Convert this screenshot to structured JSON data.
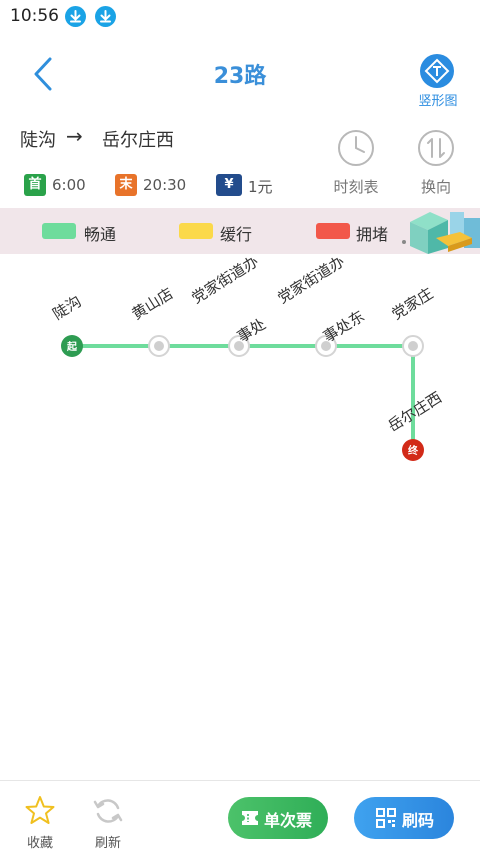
{
  "status_bar": {
    "time": "10:56",
    "icons": [
      "download-icon",
      "download-icon"
    ]
  },
  "header": {
    "title": "23路",
    "back_icon": "chevron-left-icon",
    "vertical_view_label": "竖形图",
    "accent_color": "#3a8fd9"
  },
  "route": {
    "from": "陡沟",
    "arrow": "→",
    "to": "岳尔庄西",
    "first_bus_badge": "首",
    "first_bus_time": "6:00",
    "last_bus_badge": "末",
    "last_bus_time": "20:30",
    "fare_badge": "¥",
    "fare": "1元",
    "first_badge_color": "#2aa24a",
    "last_badge_color": "#e8732a",
    "fare_badge_color": "#234c8c"
  },
  "actions": {
    "timetable_label": "时刻表",
    "reverse_label": "换向"
  },
  "legend": {
    "items": [
      {
        "label": "畅通",
        "color": "#6edc9c"
      },
      {
        "label": "缓行",
        "color": "#fbd94a"
      },
      {
        "label": "拥堵",
        "color": "#f2584a"
      }
    ]
  },
  "stops": [
    {
      "name": "陡沟",
      "tag": "起"
    },
    {
      "name": "黄山店"
    },
    {
      "name": "党家街道办事处"
    },
    {
      "name": "党家街道办事处东"
    },
    {
      "name": "党家庄"
    },
    {
      "name": "岳尔庄西",
      "tag": "终"
    }
  ],
  "stop_label_lines": [
    [
      "陡沟"
    ],
    [
      "黄山店"
    ],
    [
      "党家街道办",
      "事处"
    ],
    [
      "党家街道办",
      "事处东"
    ],
    [
      "党家庄"
    ],
    [
      "岳尔庄西"
    ]
  ],
  "bottom_bar": {
    "favorite_label": "收藏",
    "refresh_label": "刷新",
    "single_ticket_label": "单次票",
    "qr_code_label": "刷码"
  }
}
